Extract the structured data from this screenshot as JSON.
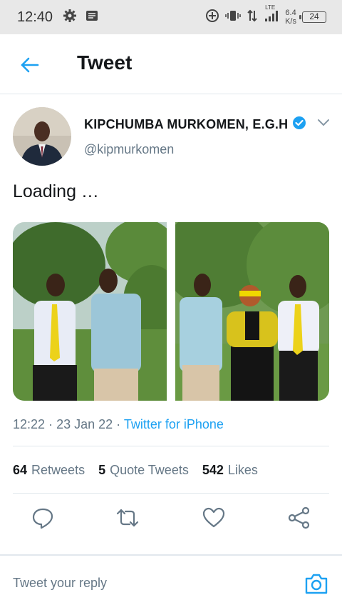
{
  "status_bar": {
    "time": "12:40",
    "network": "LTE",
    "speed_value": "6.4",
    "speed_unit": "K/s",
    "battery": "24"
  },
  "header": {
    "title": "Tweet"
  },
  "author": {
    "name": "KIPCHUMBA MURKOMEN, E.G.H",
    "handle": "@kipmurkomen",
    "verified": true
  },
  "tweet": {
    "text": "Loading …",
    "time": "12:22",
    "date": "23 Jan 22",
    "source": "Twitter for iPhone",
    "separator": "·"
  },
  "stats": {
    "retweets_count": "64",
    "retweets_label": "Retweets",
    "quote_count": "5",
    "quote_label": "Quote Tweets",
    "likes_count": "542",
    "likes_label": "Likes"
  },
  "actions": [
    "reply-icon",
    "retweet-icon",
    "like-icon",
    "share-icon"
  ],
  "reply": {
    "placeholder": "Tweet your reply"
  },
  "colors": {
    "accent": "#1da1f2",
    "text": "#14171a",
    "secondary": "#657786",
    "divider": "#e1e8ed"
  }
}
